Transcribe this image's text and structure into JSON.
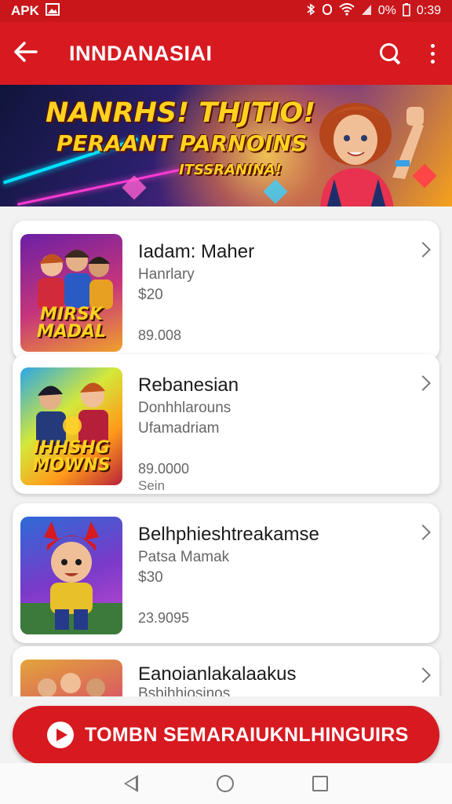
{
  "status_bar": {
    "left_label": "APK",
    "battery": "0%",
    "time": "0:39",
    "bluetooth_icon": "bluetooth-icon",
    "wifi_icon": "wifi-icon",
    "signal_icon": "signal-icon",
    "battery_icon": "battery-icon"
  },
  "app_bar": {
    "title": "INNDANASIAI",
    "back_icon": "arrow-left-icon",
    "search_icon": "search-icon",
    "more_icon": "more-vertical-icon"
  },
  "banner": {
    "line1": "NANRHS! THJTIO!",
    "line2": "PERAANT  PARNOINS",
    "line3": "ITSSRANINA!"
  },
  "items": [
    {
      "name": "Iadam: Maher",
      "subtitle": "Hanrlary",
      "price": "$20",
      "meta": "89.008",
      "meta2": "",
      "thumb_label": "MIRSK MADAL",
      "thumb_colors": [
        "#5b1b8c",
        "#c7357a"
      ]
    },
    {
      "name": "Rebanesian",
      "subtitle": "Donhhlarouns",
      "price": "Ufamadriam",
      "meta": "89.0000",
      "meta2": "Sein",
      "thumb_label": "IHHSHG MOWNS",
      "thumb_colors": [
        "#ff9a1a",
        "#2aa6e6"
      ]
    },
    {
      "name": "Belhphieshtreakamse",
      "subtitle": "Patsa Mamak",
      "price": "$30",
      "meta": "23.9095",
      "meta2": "",
      "thumb_label": "",
      "thumb_colors": [
        "#2d6bd6",
        "#c44ad1"
      ]
    },
    {
      "name": "Eanoianlakalaakus",
      "subtitle": "Bsbihhiosinos",
      "price": "",
      "meta": "",
      "meta2": "",
      "thumb_label": "",
      "thumb_colors": [
        "#e3a43a",
        "#d64a6b"
      ]
    }
  ],
  "cta": {
    "label": "TOMBN SEMARAIUKNLHINGUIRS",
    "icon": "play-icon"
  },
  "nav": {
    "back_icon": "nav-back-icon",
    "home_icon": "nav-home-icon",
    "recents_icon": "nav-recents-icon"
  },
  "colors": {
    "primary": "#d71920",
    "status_bar": "#c8161b",
    "banner_text": "#ffd21f"
  }
}
